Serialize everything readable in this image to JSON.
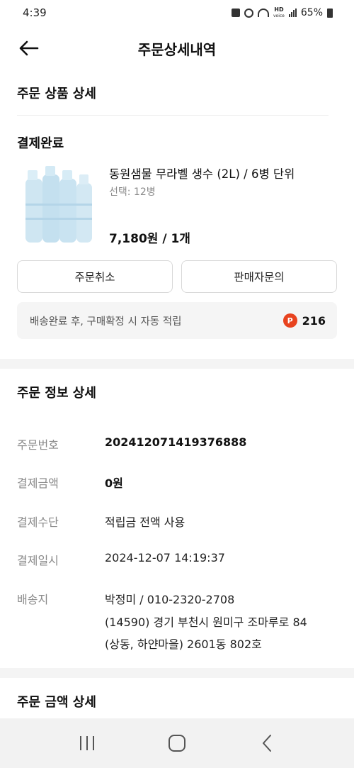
{
  "status_bar": {
    "time": "4:39",
    "battery": "65%",
    "hd_top": "HD",
    "hd_bottom": "voice"
  },
  "header": {
    "title": "주문상세내역"
  },
  "order_product": {
    "section_title": "주문 상품 상세",
    "status": "결제완료",
    "product_name": "동원샘물 무라벨 생수 (2L) / 6병 단위",
    "option": "선택: 12병",
    "price": "7,180원 / 1개",
    "cancel_button": "주문취소",
    "seller_inquiry_button": "판매자문의",
    "point_notice": "배송완료 후, 구매확정 시 자동 적립",
    "point_badge": "P",
    "point_value": "216"
  },
  "order_info": {
    "section_title": "주문 정보 상세",
    "rows": [
      {
        "label": "주문번호",
        "value": "20241207141937​6888"
      },
      {
        "label": "결제금액",
        "value": "0원"
      },
      {
        "label": "결제수단",
        "value": "적립금 전액 사용"
      },
      {
        "label": "결제일시",
        "value": "2024-12-07 14:19:37"
      }
    ],
    "delivery_label": "배송지",
    "delivery_lines": [
      "박정미 / 010-2320-2708",
      "(14590) 경기 부천시 원미구 조마루로 84",
      "(상동, 하얀마을) 2601동 802호"
    ]
  },
  "amount": {
    "section_title": "주문 금액 상세"
  },
  "colors": {
    "accent_point": "#e8431f",
    "text": "#111111",
    "muted": "#8a8a8a",
    "band": "#f4f4f4"
  }
}
